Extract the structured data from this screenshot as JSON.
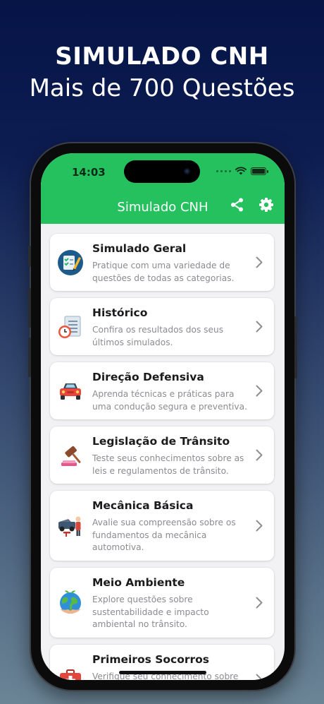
{
  "headline": {
    "title": "SIMULADO CNH",
    "subtitle": "Mais de 700 Questões"
  },
  "status_bar": {
    "time": "14:03"
  },
  "nav": {
    "title": "Simulado CNH",
    "share_icon": "share-icon",
    "settings_icon": "gear-icon",
    "accent_color": "#26c15f"
  },
  "categories": [
    {
      "title": "Simulado Geral",
      "description": "Pratique com uma variedade de questões de todas as categorias.",
      "icon": "checklist-icon"
    },
    {
      "title": "Histórico",
      "description": "Confira os resultados dos seus últimos simulados.",
      "icon": "history-icon"
    },
    {
      "title": "Direção Defensiva",
      "description": "Aprenda técnicas e práticas para uma condução segura e preventiva.",
      "icon": "car-icon"
    },
    {
      "title": "Legislação de Trânsito",
      "description": "Teste seus conhecimentos sobre as leis e regulamentos de trânsito.",
      "icon": "gavel-icon"
    },
    {
      "title": "Mecânica Básica",
      "description": "Avalie sua compreensão sobre os fundamentos da mecânica automotiva.",
      "icon": "mechanic-icon"
    },
    {
      "title": "Meio Ambiente",
      "description": "Explore questões sobre sustentabilidade e impacto ambiental no trânsito.",
      "icon": "globe-icon"
    },
    {
      "title": "Primeiros Socorros",
      "description": "Verifique seu conhecimento sobre",
      "icon": "first-aid-icon"
    }
  ]
}
